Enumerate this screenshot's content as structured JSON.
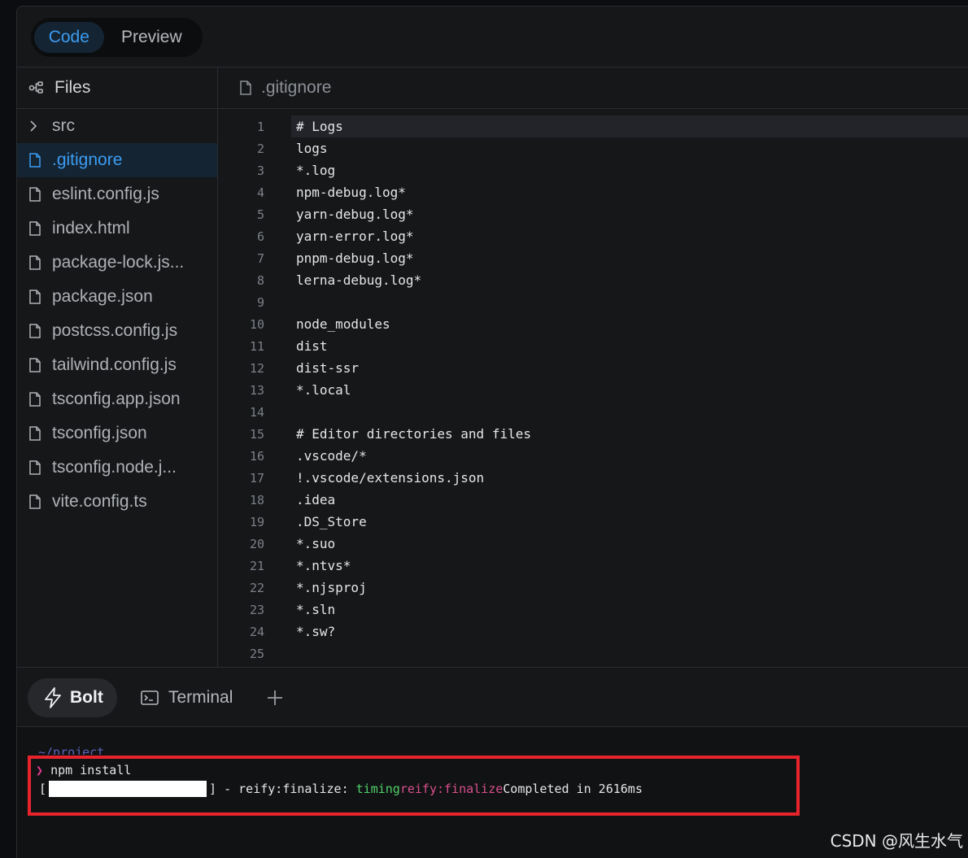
{
  "header": {
    "view_toggle": {
      "code_label": "Code",
      "preview_label": "Preview",
      "active": "Code"
    }
  },
  "sidebar": {
    "title": "Files",
    "items": [
      {
        "label": "src",
        "type": "folder"
      },
      {
        "label": ".gitignore",
        "type": "file",
        "active": true
      },
      {
        "label": "eslint.config.js",
        "type": "file"
      },
      {
        "label": "index.html",
        "type": "file"
      },
      {
        "label": "package-lock.js...",
        "type": "file"
      },
      {
        "label": "package.json",
        "type": "file"
      },
      {
        "label": "postcss.config.js",
        "type": "file"
      },
      {
        "label": "tailwind.config.js",
        "type": "file"
      },
      {
        "label": "tsconfig.app.json",
        "type": "file"
      },
      {
        "label": "tsconfig.json",
        "type": "file"
      },
      {
        "label": "tsconfig.node.j...",
        "type": "file"
      },
      {
        "label": "vite.config.ts",
        "type": "file"
      }
    ]
  },
  "editor": {
    "tab_label": ".gitignore",
    "current_line": 1,
    "lines": [
      "# Logs",
      "logs",
      "*.log",
      "npm-debug.log*",
      "yarn-debug.log*",
      "yarn-error.log*",
      "pnpm-debug.log*",
      "lerna-debug.log*",
      "",
      "node_modules",
      "dist",
      "dist-ssr",
      "*.local",
      "",
      "# Editor directories and files",
      ".vscode/*",
      "!.vscode/extensions.json",
      ".idea",
      ".DS_Store",
      "*.suo",
      "*.ntvs*",
      "*.njsproj",
      "*.sln",
      "*.sw?",
      ""
    ]
  },
  "panel": {
    "bolt_label": "Bolt",
    "terminal_label": "Terminal"
  },
  "terminal": {
    "path": "~/project",
    "prompt_symbol": "❯",
    "command": "npm install",
    "progress_open": "[",
    "progress_close": "]",
    "status_prefix": " - reify:finalize: ",
    "status_timing": "timing",
    "status_name": "reify:finalize",
    "status_rest": "Completed in 2616ms"
  },
  "watermark": "CSDN @风生水气",
  "colors": {
    "accent": "#3b9cf1",
    "active_bg": "#152433",
    "highlight_box": "#e8232c",
    "terminal_green": "#4fd168",
    "terminal_magenta": "#d8508d"
  }
}
